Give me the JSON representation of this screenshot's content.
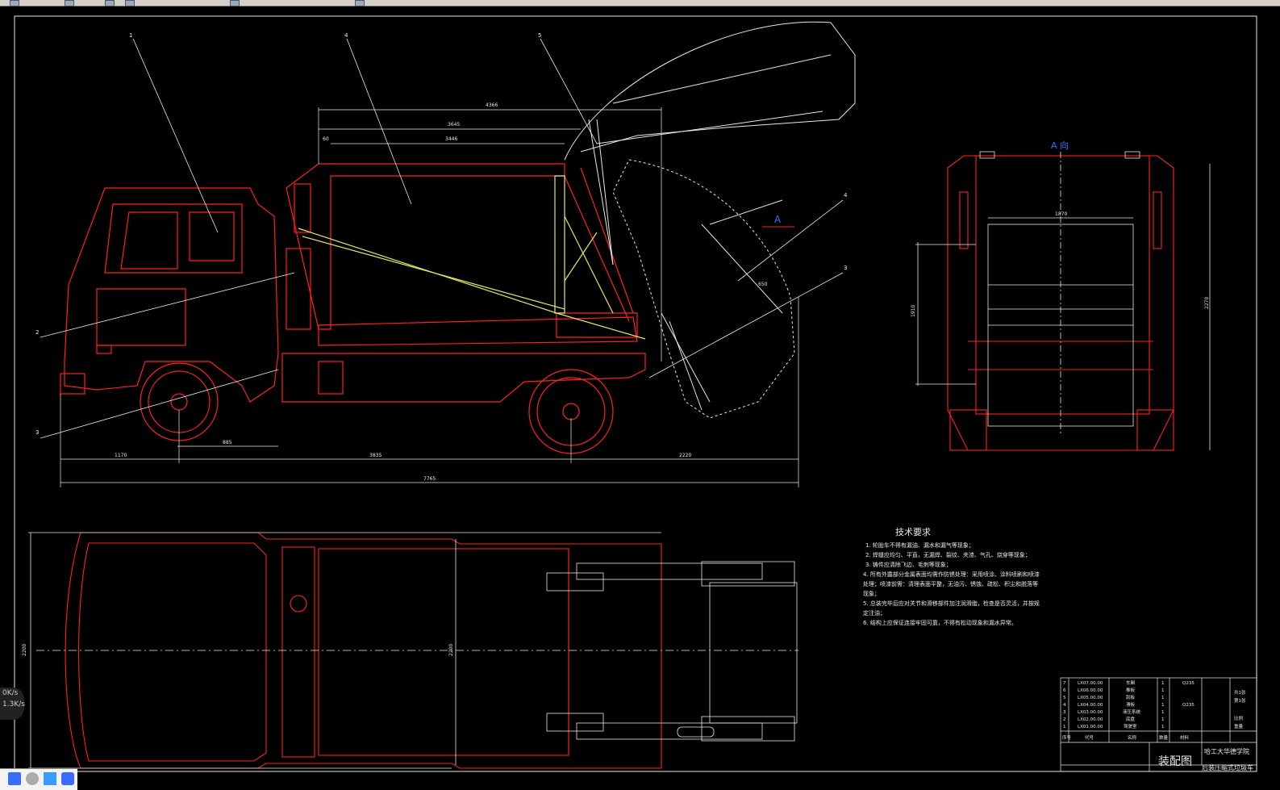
{
  "app": {
    "name": "CAD drawing viewer"
  },
  "icons": [
    "toolbar-open-icon",
    "toolbar-save-icon",
    "toolbar-zoom-icon",
    "toolbar-pan-icon",
    "toolbar-layer-icon",
    "toolbar-help-icon"
  ],
  "colors": {
    "background": "#000000",
    "red_lines": "#ff2020",
    "white_lines": "#e8e8e8",
    "yellow_lines": "#e8e860",
    "blue_text": "#3a6bff"
  },
  "side_view": {
    "leaders": [
      "1",
      "4",
      "5",
      "4",
      "2",
      "3",
      "3"
    ],
    "dims_top": [
      "4366",
      "3645",
      "3446",
      "60"
    ],
    "dims_bottom": [
      "1170",
      "885",
      "3835",
      "2220"
    ],
    "overall": "7765",
    "section_label": "A",
    "angle": "650"
  },
  "rear_view": {
    "title": "A 向",
    "width_dim": "1870",
    "height_dim": "2270",
    "side_dim": "1910"
  },
  "plan_view": {
    "width_left": "2200",
    "width_mid": "2200"
  },
  "tech_requirements": {
    "title": "技术要求",
    "items": [
      "1. 轮胎车不得有漏油、漏水和漏气等现象；",
      "2. 焊缝应均匀、平直，无漏焊、裂纹、夹渣、气孔、烧穿等现象；",
      "3. 铸件应清除飞边、毛刺等现象；",
      "4. 所有外露部分金属表面均需作防锈处理：采用喷涂、涂料喷刷和喷漆处理；喷漆前需：清理表面平整，无油污、锈蚀、疏松、积尘和脱落等现象；",
      "5. 总装完毕后应对关节和滑移部件加注润滑脂，检查是否灵活，并按规定注油；",
      "6. 结构上应保证连接牢固可靠，不得有松动现象和漏水异常。"
    ]
  },
  "title_block": {
    "parts": [
      {
        "no": "7",
        "code": "LX07.00.00",
        "name": "车厢",
        "qty": "1",
        "material": "Q235"
      },
      {
        "no": "6",
        "code": "LX06.00.00",
        "name": "推板",
        "qty": "1",
        "material": ""
      },
      {
        "no": "5",
        "code": "LX05.00.00",
        "name": "刮板",
        "qty": "1",
        "material": ""
      },
      {
        "no": "4",
        "code": "LX04.00.00",
        "name": "滑板",
        "qty": "1",
        "material": "Q235"
      },
      {
        "no": "3",
        "code": "LX03.00.00",
        "name": "液压系统",
        "qty": "1",
        "material": ""
      },
      {
        "no": "2",
        "code": "LX02.00.00",
        "name": "底盘",
        "qty": "1",
        "material": ""
      },
      {
        "no": "1",
        "code": "LX01.00.00",
        "name": "驾驶室",
        "qty": "1",
        "material": ""
      }
    ],
    "headers": [
      "序号",
      "代号",
      "名称",
      "数量",
      "材料"
    ],
    "right_labels": [
      "共1张",
      "第1张",
      "比例",
      "重量"
    ],
    "drawing_title": "装配图",
    "school": "哈工大华德学院",
    "project": "后装压缩式垃圾车"
  },
  "netspeed": {
    "down": "0",
    "up": "1.3",
    "unit": "K/s"
  }
}
